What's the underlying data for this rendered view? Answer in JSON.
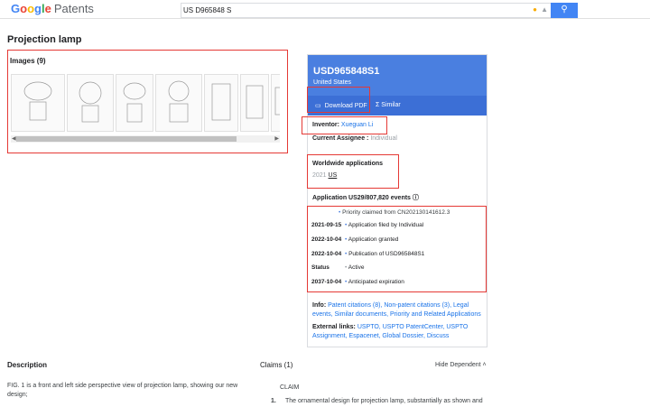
{
  "header": {
    "logo_google": "Google",
    "logo_patents": "Patents",
    "search_value": "US D965848 S"
  },
  "page": {
    "title": "Projection lamp"
  },
  "images": {
    "label": "Images (9)"
  },
  "card": {
    "patent_number": "USD965848S1",
    "country": "United States",
    "download_label": "Download PDF",
    "similar_label": "Similar",
    "inventor_label": "Inventor:",
    "inventor_value": "Xueguan Li",
    "assignee_label": "Current Assignee :",
    "assignee_value": "Individual",
    "worldwide_label": "Worldwide applications",
    "worldwide_year": "2021",
    "worldwide_country": "US",
    "application_events": "Application US29/807,820 events",
    "events": [
      {
        "date": "",
        "text": "Priority claimed from CN202130141612.3"
      },
      {
        "date": "2021-09-15",
        "text": "Application filed by Individual"
      },
      {
        "date": "2022-10-04",
        "text": "Application granted"
      },
      {
        "date": "2022-10-04",
        "text": "Publication of USD965848S1"
      },
      {
        "date": "Status",
        "text": "Active"
      },
      {
        "date": "2037-10-04",
        "text": "Anticipated expiration"
      }
    ],
    "info_label": "Info:",
    "info_links": "Patent citations (8), Non-patent citations (3), Legal events, Similar documents, Priority and Related Applications",
    "external_label": "External links:",
    "external_links": "USPTO, USPTO PatentCenter, USPTO Assignment, Espacenet, Global Dossier, Discuss"
  },
  "description": {
    "heading": "Description",
    "text": "FIG. 1 is a front and left side perspective view of projection lamp, showing our new design;"
  },
  "claims": {
    "heading": "Claims (1)",
    "hide_label": "Hide Dependent",
    "claim_label": "CLAIM",
    "number": "1.",
    "text": "The ornamental design for projection lamp, substantially as shown and"
  },
  "colors": {
    "accent": "#4a7fe0",
    "link": "#1a73e8",
    "highlight": "#e53935"
  }
}
